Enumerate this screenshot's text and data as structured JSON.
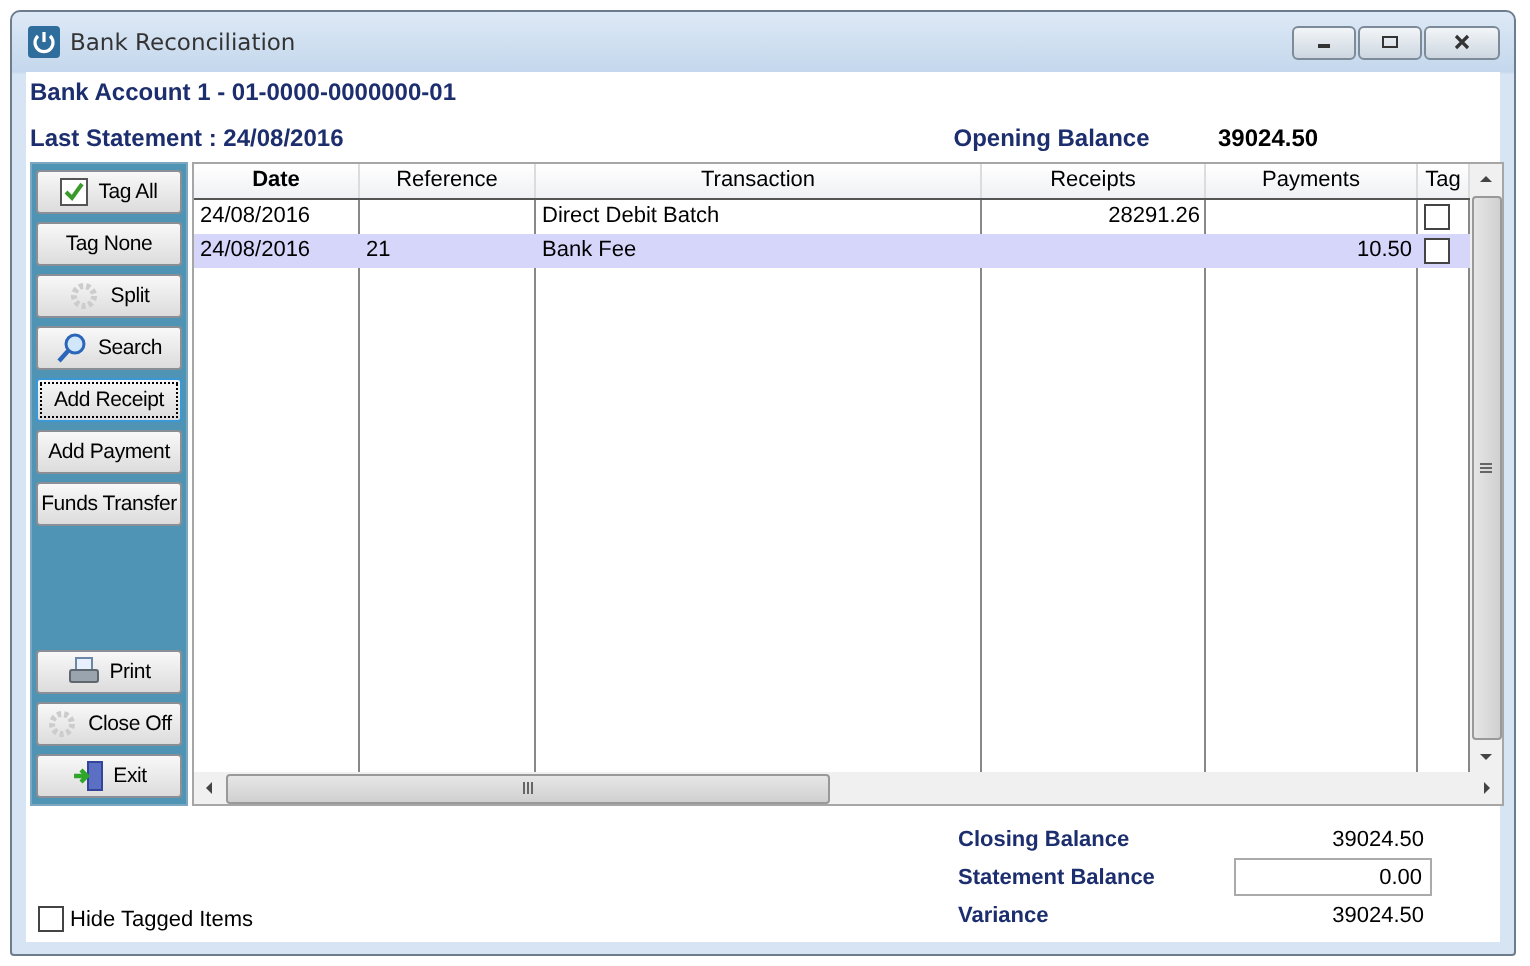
{
  "window": {
    "title": "Bank Reconciliation"
  },
  "account": "Bank Account 1 - 01-0000-0000000-01",
  "last_statement": "Last Statement : 24/08/2016",
  "opening_balance": {
    "label": "Opening Balance",
    "value": "39024.50"
  },
  "buttons": [
    {
      "label": "Tag All",
      "kind": "check",
      "focused": false
    },
    {
      "label": "Tag None",
      "kind": "plain",
      "focused": false
    },
    {
      "label": "Split",
      "kind": "gear",
      "focused": false
    },
    {
      "label": "Search",
      "kind": "search",
      "focused": false
    },
    {
      "label": "Add Receipt",
      "kind": "plain",
      "focused": true
    },
    {
      "label": "Add Payment",
      "kind": "plain",
      "focused": false
    },
    {
      "label": "Funds Transfer",
      "kind": "plain",
      "focused": false
    }
  ],
  "bottom_buttons": [
    {
      "label": "Print",
      "kind": "print",
      "focused": false
    },
    {
      "label": "Close Off",
      "kind": "gear",
      "focused": false
    },
    {
      "label": "Exit",
      "kind": "exit",
      "focused": false
    }
  ],
  "table": {
    "columns": [
      {
        "label": "Date",
        "sorted": true
      },
      {
        "label": "Reference",
        "sorted": false
      },
      {
        "label": "Transaction",
        "sorted": false
      },
      {
        "label": "Receipts",
        "sorted": false
      },
      {
        "label": "Payments",
        "sorted": false
      },
      {
        "label": "Tag",
        "sorted": false
      }
    ],
    "rows": [
      {
        "date": "24/08/2016",
        "reference": "",
        "transaction": "Direct Debit Batch",
        "receipts": "28291.26",
        "payments": "",
        "tagged": false,
        "selected": false
      },
      {
        "date": "24/08/2016",
        "reference": "21",
        "transaction": "Bank Fee",
        "receipts": "",
        "payments": "10.50",
        "tagged": false,
        "selected": true
      }
    ]
  },
  "totals": {
    "closing_balance": {
      "label": "Closing Balance",
      "value": "39024.50"
    },
    "statement_balance": {
      "label": "Statement Balance",
      "value": "0.00"
    },
    "variance": {
      "label": "Variance",
      "value": "39024.50"
    }
  },
  "hide_tagged": {
    "label": "Hide Tagged Items",
    "checked": false
  }
}
